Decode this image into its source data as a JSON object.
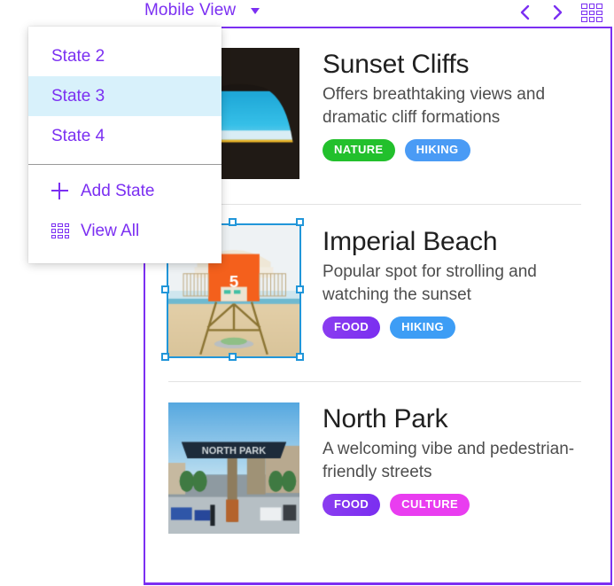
{
  "header": {
    "view_label": "Mobile View",
    "caret_icon": "chevron-down-icon",
    "prev_icon": "chevron-left-icon",
    "next_icon": "chevron-right-icon",
    "grid_icon": "grid-view-icon",
    "accent_color": "#7b2ff2"
  },
  "dropdown": {
    "visible": true,
    "selected_value": "State 3",
    "highlight_color": "#d8f1fb",
    "items": [
      {
        "label": "State 2",
        "selected": false
      },
      {
        "label": "State 3",
        "selected": true
      },
      {
        "label": "State 4",
        "selected": false
      }
    ],
    "actions": [
      {
        "label": "Add State",
        "icon": "plus-icon"
      },
      {
        "label": "View All",
        "icon": "grid-view-icon"
      }
    ]
  },
  "panel": {
    "border_color": "#7b2ff2",
    "selection_color": "#2196d9"
  },
  "cards": [
    {
      "title": "Sunset Cliffs",
      "description": "Offers breathtaking views and dramatic cliff formations",
      "image_name": "sunset-cliffs-cave-silhouette-photo",
      "selected": false,
      "tags": [
        {
          "label": "NATURE",
          "color": "#22c02c"
        },
        {
          "label": "HIKING",
          "color": "#4a9bf5"
        }
      ]
    },
    {
      "title": "Imperial Beach",
      "description": "Popular spot for strolling and watching the sunset",
      "image_name": "imperial-beach-lifeguard-tower-5-photo",
      "selected": true,
      "tags": [
        {
          "label": "FOOD",
          "color": "#8b3df0"
        },
        {
          "label": "HIKING",
          "color": "#3d9df5"
        }
      ]
    },
    {
      "title": "North Park",
      "description": "A welcoming vibe and pedestrian-friendly streets",
      "image_name": "north-park-sign-street-photo",
      "selected": false,
      "tags": [
        {
          "label": "FOOD",
          "color": "#8b3df0"
        },
        {
          "label": "CULTURE",
          "color": "#e93df0"
        }
      ]
    }
  ]
}
